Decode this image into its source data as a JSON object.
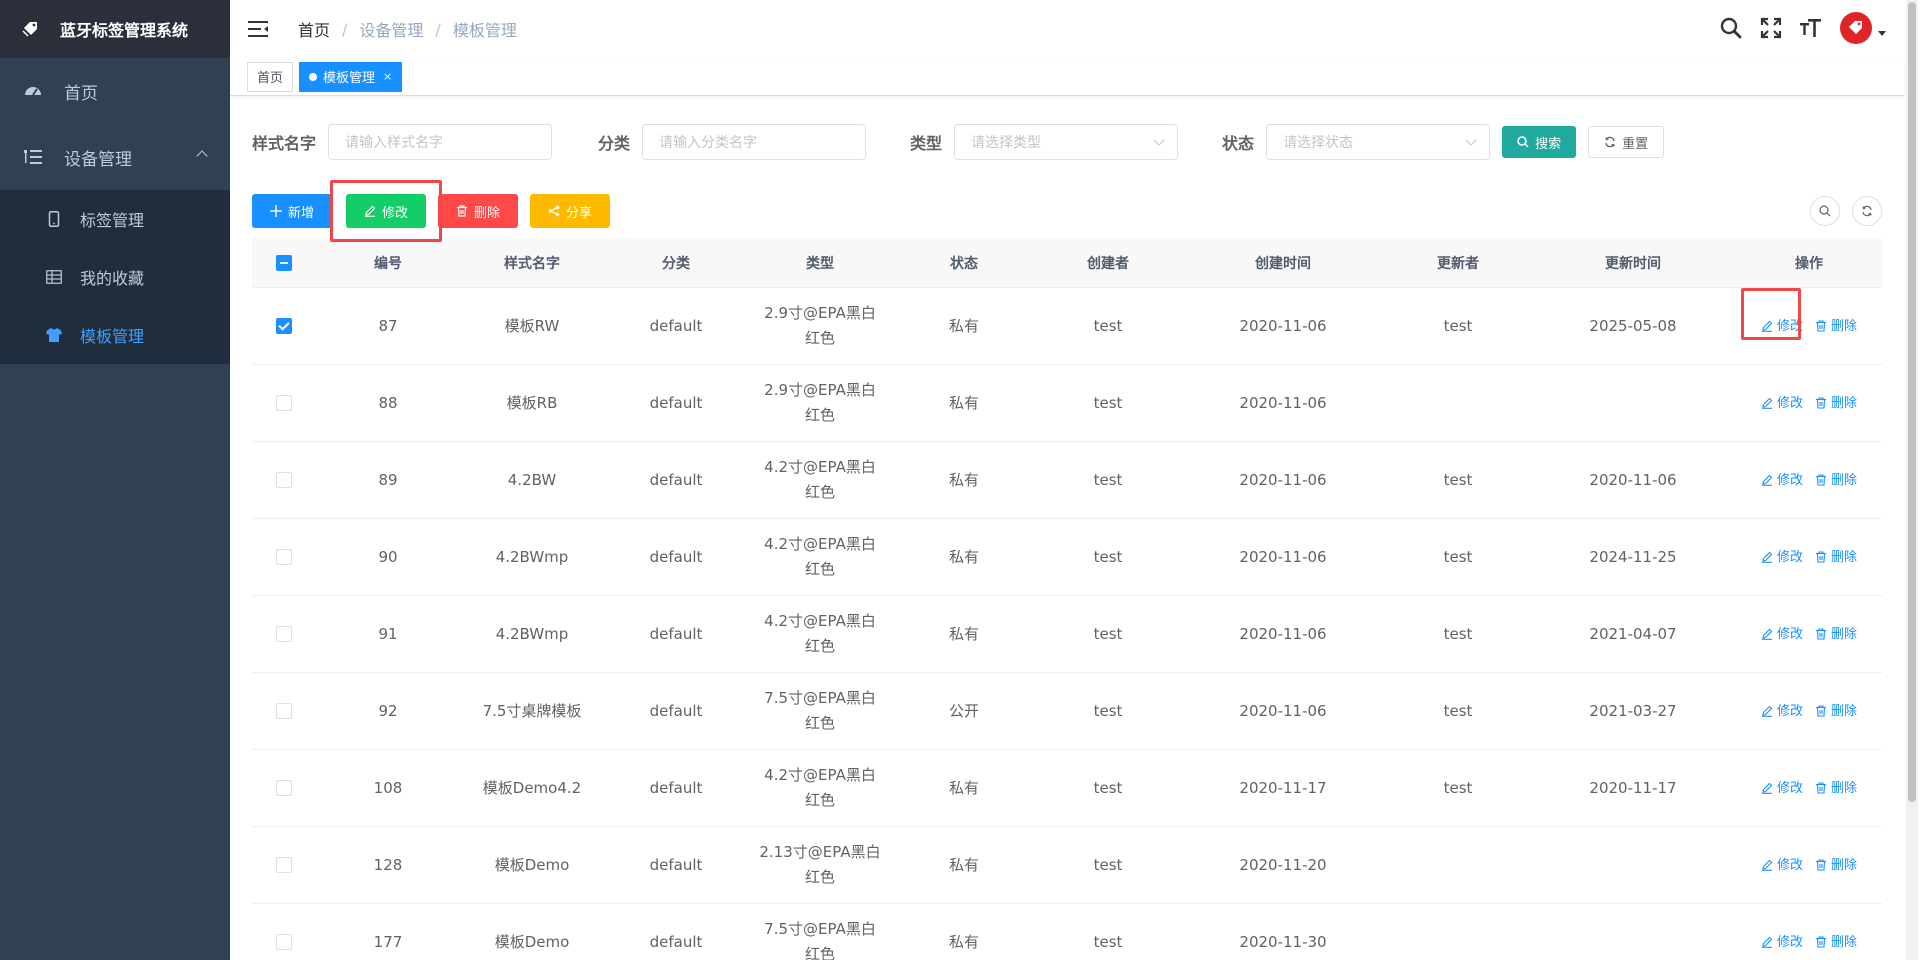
{
  "app": {
    "title": "蓝牙标签管理系统"
  },
  "sidebar": {
    "items": [
      {
        "label": "首页",
        "icon": "dashboard-icon"
      },
      {
        "label": "设备管理",
        "icon": "tree-icon",
        "expanded": true,
        "children": [
          {
            "label": "标签管理",
            "icon": "phone-icon"
          },
          {
            "label": "我的收藏",
            "icon": "table-icon"
          },
          {
            "label": "模板管理",
            "icon": "shirt-icon",
            "active": true
          }
        ]
      }
    ]
  },
  "breadcrumb": [
    "首页",
    "设备管理",
    "模板管理"
  ],
  "tags": {
    "home": "首页",
    "current": "模板管理",
    "close": "×"
  },
  "search": {
    "name_label": "样式名字",
    "name_placeholder": "请输入样式名字",
    "category_label": "分类",
    "category_placeholder": "请输入分类名字",
    "type_label": "类型",
    "type_placeholder": "请选择类型",
    "status_label": "状态",
    "status_placeholder": "请选择状态",
    "search_btn": "搜索",
    "reset_btn": "重置"
  },
  "toolbar": {
    "add": "新增",
    "edit": "修改",
    "delete": "删除",
    "share": "分享"
  },
  "table": {
    "headers": [
      "编号",
      "样式名字",
      "分类",
      "类型",
      "状态",
      "创建者",
      "创建时间",
      "更新者",
      "更新时间",
      "操作"
    ],
    "header_checkbox": "indeterminate",
    "rows": [
      {
        "checked": true,
        "id": "87",
        "name": "模板RW",
        "category": "default",
        "type1": "2.9寸@EPA黑白",
        "type2": "红色",
        "status": "私有",
        "creator": "test",
        "created": "2020-11-06",
        "updater": "test",
        "updated": "2025-05-08"
      },
      {
        "checked": false,
        "id": "88",
        "name": "模板RB",
        "category": "default",
        "type1": "2.9寸@EPA黑白",
        "type2": "红色",
        "status": "私有",
        "creator": "test",
        "created": "2020-11-06",
        "updater": "",
        "updated": ""
      },
      {
        "checked": false,
        "id": "89",
        "name": "4.2BW",
        "category": "default",
        "type1": "4.2寸@EPA黑白",
        "type2": "红色",
        "status": "私有",
        "creator": "test",
        "created": "2020-11-06",
        "updater": "test",
        "updated": "2020-11-06"
      },
      {
        "checked": false,
        "id": "90",
        "name": "4.2BWmp",
        "category": "default",
        "type1": "4.2寸@EPA黑白",
        "type2": "红色",
        "status": "私有",
        "creator": "test",
        "created": "2020-11-06",
        "updater": "test",
        "updated": "2024-11-25"
      },
      {
        "checked": false,
        "id": "91",
        "name": "4.2BWmp",
        "category": "default",
        "type1": "4.2寸@EPA黑白",
        "type2": "红色",
        "status": "私有",
        "creator": "test",
        "created": "2020-11-06",
        "updater": "test",
        "updated": "2021-04-07"
      },
      {
        "checked": false,
        "id": "92",
        "name": "7.5寸桌牌模板",
        "category": "default",
        "type1": "7.5寸@EPA黑白",
        "type2": "红色",
        "status": "公开",
        "creator": "test",
        "created": "2020-11-06",
        "updater": "test",
        "updated": "2021-03-27"
      },
      {
        "checked": false,
        "id": "108",
        "name": "模板Demo4.2",
        "category": "default",
        "type1": "4.2寸@EPA黑白",
        "type2": "红色",
        "status": "私有",
        "creator": "test",
        "created": "2020-11-17",
        "updater": "test",
        "updated": "2020-11-17"
      },
      {
        "checked": false,
        "id": "128",
        "name": "模板Demo",
        "category": "default",
        "type1": "2.13寸@EPA黑白",
        "type2": "红色",
        "status": "私有",
        "creator": "test",
        "created": "2020-11-20",
        "updater": "",
        "updated": ""
      },
      {
        "checked": false,
        "id": "177",
        "name": "模板Demo",
        "category": "default",
        "type1": "7.5寸@EPA黑白",
        "type2": "红色",
        "status": "私有",
        "creator": "test",
        "created": "2020-11-30",
        "updater": "",
        "updated": ""
      }
    ],
    "op_edit": "修改",
    "op_delete": "删除"
  },
  "colors": {
    "sidebar": "#304156",
    "primary": "#1890ff",
    "success": "#13ce66",
    "danger": "#ff4949",
    "warning": "#ffba00",
    "teal": "#20a99f",
    "highlight": "#f04848"
  }
}
